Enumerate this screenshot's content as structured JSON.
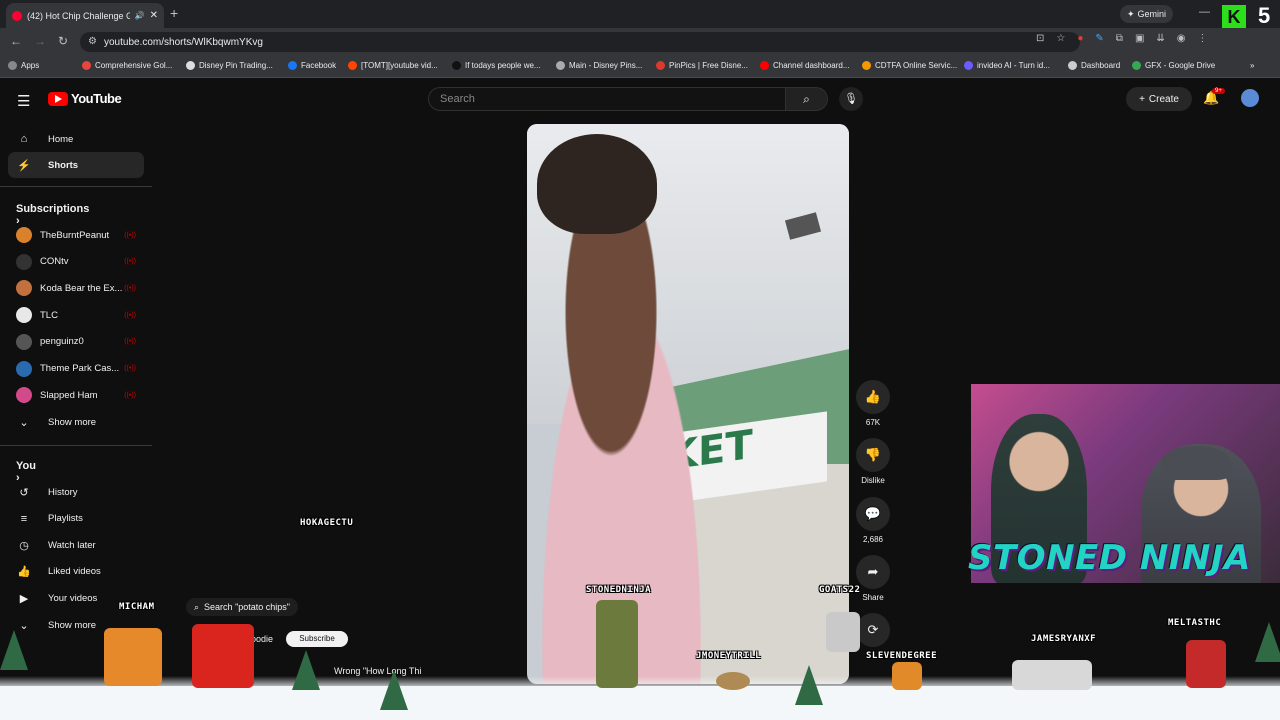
{
  "browser": {
    "tab_title": "(42) Hot Chip Challenge Go...",
    "new_tab": "+",
    "gemini_label": "Gemini",
    "url": "youtube.com/shorts/WlKbqwmYKvg",
    "bookmarks": [
      {
        "label": "Apps",
        "color": "#888888"
      },
      {
        "label": "Comprehensive Gol...",
        "color": "#e8453c"
      },
      {
        "label": "Disney Pin Trading...",
        "color": "#dddddd"
      },
      {
        "label": "Facebook",
        "color": "#1877f2"
      },
      {
        "label": "[TOMT][youtube vid...",
        "color": "#ff4500"
      },
      {
        "label": "If todays people we...",
        "color": "#111111"
      },
      {
        "label": "Main - Disney Pins...",
        "color": "#aaaaaa"
      },
      {
        "label": "PinPics | Free Disne...",
        "color": "#d93a2b"
      },
      {
        "label": "Channel dashboard...",
        "color": "#ff0000"
      },
      {
        "label": "CDTFA Online Servic...",
        "color": "#f29900"
      },
      {
        "label": "invideo AI - Turn id...",
        "color": "#6a5cff"
      },
      {
        "label": "Dashboard",
        "color": "#cccccc"
      },
      {
        "label": "GFX - Google Drive",
        "color": "#34a853"
      }
    ]
  },
  "youtube": {
    "logo_text": "YouTube",
    "search_placeholder": "Search",
    "create_label": "Create",
    "notif_count": "9+",
    "nav": [
      {
        "label": "Home",
        "icon": "home-icon",
        "glyph": "⌂"
      },
      {
        "label": "Shorts",
        "icon": "shorts-icon",
        "glyph": "⚡"
      }
    ],
    "subscriptions_heading": "Subscriptions",
    "subscriptions": [
      {
        "label": "TheBurntPeanut",
        "color": "#d9822b"
      },
      {
        "label": "CONtv",
        "color": "#333333"
      },
      {
        "label": "Koda Bear the Ex...",
        "color": "#c2703d"
      },
      {
        "label": "TLC",
        "color": "#e8e8e8"
      },
      {
        "label": "penguinz0",
        "color": "#555555"
      },
      {
        "label": "Theme Park Cas...",
        "color": "#2a6bb0"
      },
      {
        "label": "Slapped Ham",
        "color": "#d24a8a"
      }
    ],
    "show_more_1": "Show more",
    "you_heading": "You",
    "you_items": [
      {
        "label": "History",
        "glyph": "↺"
      },
      {
        "label": "Playlists",
        "glyph": "≡"
      },
      {
        "label": "Watch later",
        "glyph": "◷"
      },
      {
        "label": "Liked videos",
        "glyph": "👍"
      },
      {
        "label": "Your videos",
        "glyph": "▶"
      }
    ],
    "show_more_2": "Show more",
    "actions": {
      "likes": "67K",
      "dislike": "Dislike",
      "comments": "2,686",
      "share": "Share"
    },
    "video_sign": "KET",
    "search_pill": "Search \"potato chips\"",
    "channel_name": "goodie",
    "subscribe": "Subscribe",
    "caption": "Wrong \"How Long Thi"
  },
  "overlay": {
    "streamer_title": "STONED NINJA",
    "k_letter": "K",
    "k_number": "5",
    "usernames": [
      {
        "name": "HOKAGECTU"
      },
      {
        "name": "MICHAM"
      },
      {
        "name": "STONEDNINJA"
      },
      {
        "name": "GOATS22"
      },
      {
        "name": "JMONEYTRILL"
      },
      {
        "name": "SLEVENDEGREE"
      },
      {
        "name": "JAMESRYANXF"
      },
      {
        "name": "MELTASTHC"
      }
    ]
  }
}
